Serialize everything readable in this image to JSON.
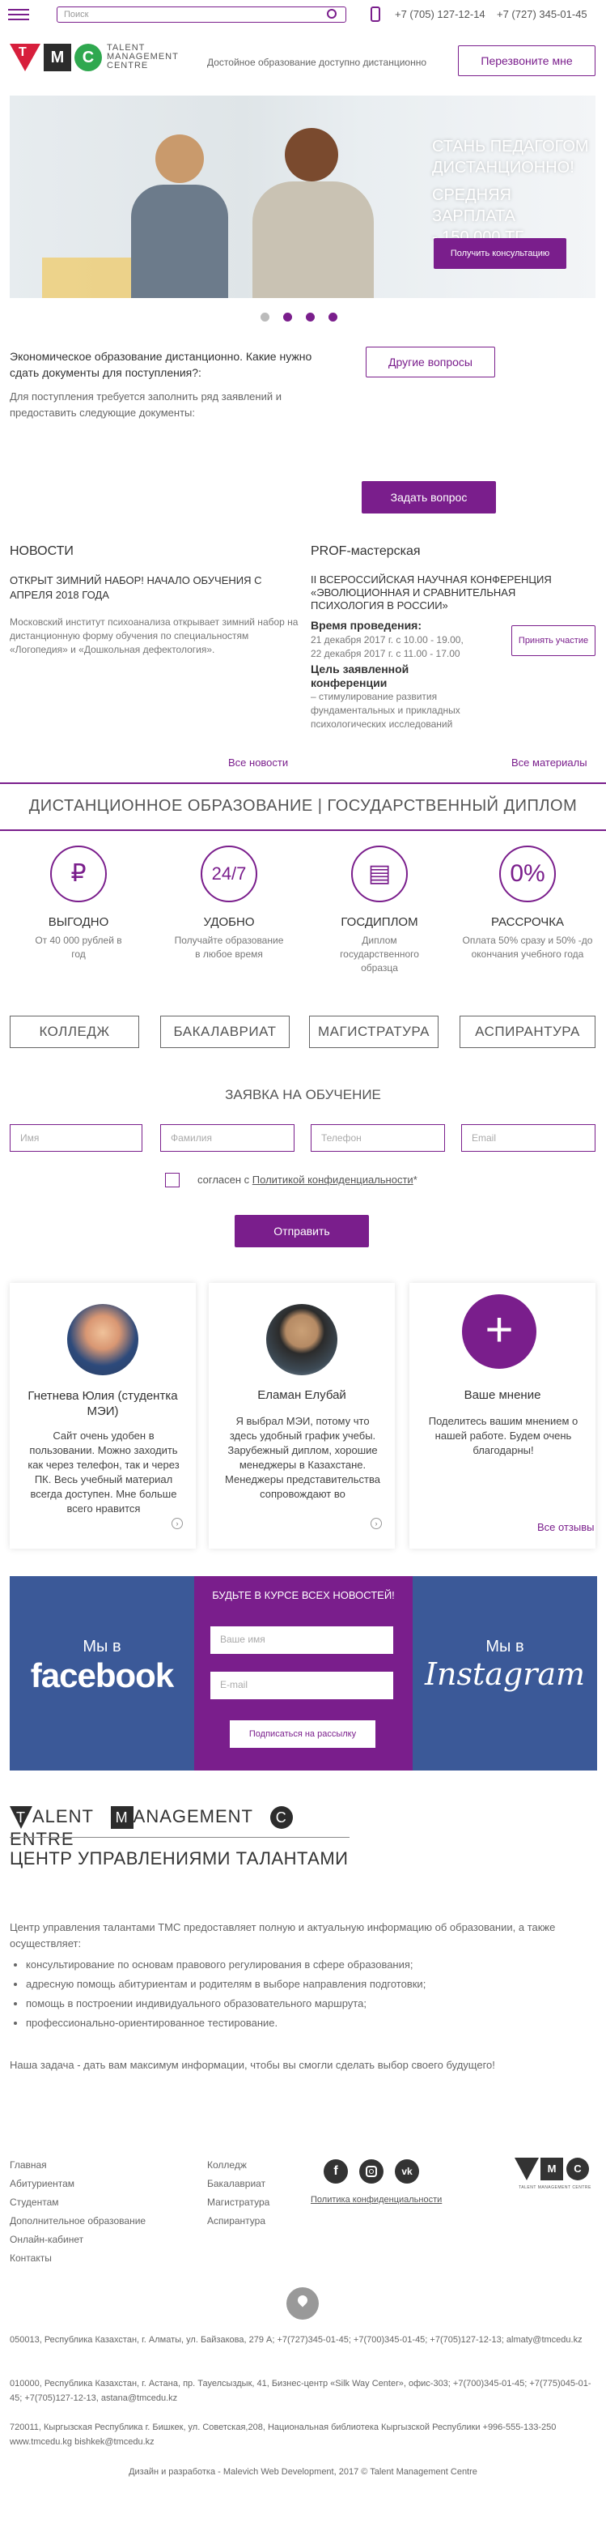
{
  "header": {
    "search_placeholder": "Поиск",
    "phone1": "+7 (705) 127-12-14",
    "phone2": "+7 (727) 345-01-45",
    "logo_text": [
      "TALENT",
      "MANAGEMENT",
      "CENTRE"
    ],
    "tagline": "Достойное образование доступно дистанционно",
    "callback_label": "Перезвоните мне"
  },
  "hero": {
    "line1": "СТАНЬ ПЕДАГОГОМ",
    "line2": "ДИСТАНЦИОННО!",
    "line3": "СРЕДНЯЯ ЗАРПЛАТА",
    "line4": "- 150 000 ТГ",
    "cta": "Получить консультацию"
  },
  "faq": {
    "question": "Экономическое образование дистанционно. Какие нужно сдать документы для поступления?:",
    "answer": "Для поступления требуется заполнить ряд заявлений и предоставить следующие документы:",
    "other_button": "Другие вопросы",
    "ask_button": "Задать вопрос"
  },
  "news": {
    "title": "НОВОСТИ",
    "headline": "ОТКРЫТ ЗИМНИЙ НАБОР! НАЧАЛО ОБУЧЕНИЯ С АПРЕЛЯ 2018 ГОДА",
    "text": "Московский институт психоанализа открывает зимний набор на дистанционную форму обучения по специальностям «Логопедия» и «Дошкольная дефектология».",
    "all": "Все новости"
  },
  "prof": {
    "title": "PROF-мастерская",
    "headline": "II ВСЕРОССИЙСКАЯ НАУЧНАЯ КОНФЕРЕНЦИЯ «ЭВОЛЮЦИОННАЯ И СРАВНИТЕЛЬНАЯ ПСИХОЛОГИЯ В РОССИИ»",
    "time_label": "Время проведения:",
    "time1": "21 декабря 2017 г. с 10.00 - 19.00,",
    "time2": "22 декабря 2017 г. с 11.00 - 17.00",
    "goal_label": "Цель заявленной конференции",
    "goal_text": "– стимулирование развития фундаментальных и прикладных психологических исследований",
    "participate": "Принять участие",
    "all": "Все материалы"
  },
  "distance_title": "ДИСТАНЦИОННОЕ ОБРАЗОВАНИЕ | ГОСУДАРСТВЕННЫЙ ДИПЛОМ",
  "features": [
    {
      "icon": "₽",
      "title": "ВЫГОДНО",
      "text": "От 40 000 рублей в год"
    },
    {
      "icon": "24/7",
      "title": "УДОБНО",
      "text": "Получайте образование в любое время"
    },
    {
      "icon": "▤",
      "title": "ГОСДИПЛОМ",
      "text": "Диплом государственного образца"
    },
    {
      "icon": "0%",
      "title": "РАССРОЧКА",
      "text": "Оплата 50% сразу и 50% -до окончания учебного года"
    }
  ],
  "programs": [
    "КОЛЛЕДЖ",
    "БАКАЛАВРИАТ",
    "МАГИСТРАТУРА",
    "АСПИРАНТУРА"
  ],
  "form": {
    "title": "ЗАЯВКА НА ОБУЧЕНИЕ",
    "name": "Имя",
    "surname": "Фамилия",
    "phone": "Телефон",
    "email": "Email",
    "agree_prefix": "согласен с ",
    "agree_link": "Политикой конфиденциальности",
    "agree_suffix": "*",
    "submit": "Отправить"
  },
  "reviews": [
    {
      "name": "Гнетнева Юлия (студентка МЭИ)",
      "text": "Сайт очень удобен в пользовании. Можно заходить как через телефон, так и через ПК. Весь учебный материал всегда доступен. Мне больше всего нравится"
    },
    {
      "name": "Еламан Елубай",
      "text": "Я выбрал МЭИ, потому что здесь удобный график учебы. Зарубежный диплом, хорошие менеджеры в Казахстане. Менеджеры представительства сопровождают во"
    },
    {
      "name": "Ваше мнение",
      "text": "Поделитесь вашим мнением о нашей работе. Будем очень благодарны!",
      "link": "Все отзывы"
    }
  ],
  "social": {
    "fb_pre": "Мы в",
    "fb_name": "facebook",
    "news_title": "БУДЬТЕ В КУРСЕ ВСЕХ НОВОСТЕЙ!",
    "name_ph": "Ваше имя",
    "email_ph": "E-mail",
    "subscribe": "Подписаться на рассылку",
    "ig_pre": "Мы в",
    "ig_name": "Instagram"
  },
  "about": {
    "logo_words": [
      "ALENT",
      "ANAGEMENT",
      "ENTRE"
    ],
    "logo_letters": [
      "T",
      "M",
      "C"
    ],
    "title": "ЦЕНТР УПРАВЛЕНИЯМИ ТАЛАНТАМИ",
    "intro": "Центр управления талантами ТМС предоставляет полную и актуальную информацию об образовании, а также осуществляет:",
    "items": [
      "консультирование по основам правового регулирования в сфере образования;",
      "адресную помощь абитуриентам и родителям в выборе направления подготовки;",
      "помощь в построении индивидуального образовательного маршрута;",
      "профессионально-ориентированное тестирование."
    ],
    "outro": "Наша задача - дать вам максимум информации, чтобы вы смогли сделать выбор своего будущего!"
  },
  "footer": {
    "col1": [
      "Главная",
      "Абитуриентам",
      "Студентам",
      "Дополнительное образование",
      "Онлайн-кабинет",
      "Контакты"
    ],
    "col2": [
      "Колледж",
      "Бакалавриат",
      "Магистратура",
      "Аспирантура"
    ],
    "privacy": "Политика конфиденциальности",
    "logo_sub": "TALENT MANAGEMENT CENTRE",
    "addr1": "050013, Республика Казахстан, г. Алматы, ул. Байзакова, 279 А; +7(727)345-01-45; +7(700)345-01-45; +7(705)127-12-13; almaty@tmcedu.kz",
    "addr2": "010000, Республика Казахстан, г. Астана, пр. Тауелсыздык, 41, Бизнес-центр «Silk Way Center», офис-303; +7(700)345-01-45; +7(775)045-01-45; +7(705)127-12-13, astana@tmcedu.kz",
    "addr3": "720011, Кыргызская Республика г. Бишкек, ул. Советская,208, Национальная библиотека Кыргызской Республики +996-555-133-250 www.tmcedu.kg bishkek@tmcedu.kz",
    "copyright": "Дизайн и разработка - Malevich Web Development, 2017 © Talent Management Centre"
  },
  "colors": {
    "accent": "#7a1e8c",
    "facebook": "#3b5998",
    "instagram": "#3b5998"
  }
}
